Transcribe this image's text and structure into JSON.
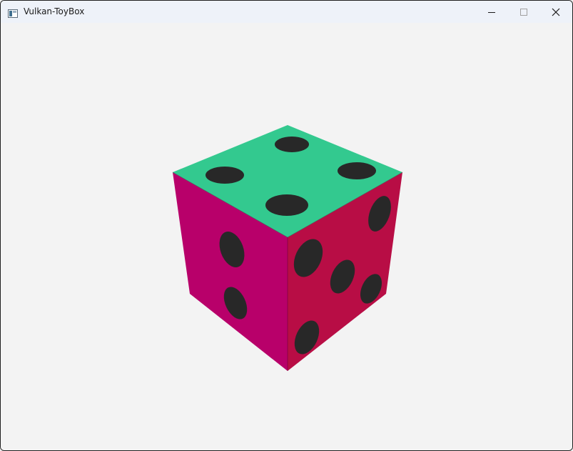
{
  "window": {
    "title": "Vulkan-ToyBox",
    "controls": {
      "minimize": "minimize-icon",
      "maximize": "maximize-icon",
      "close": "close-icon"
    }
  },
  "scene": {
    "object": "dice",
    "colors": {
      "background": "#f3f3f3",
      "top_face": "#33c98f",
      "left_face": "#b8006a",
      "right_face": "#b80d45",
      "pips": "#282828"
    },
    "visible_faces": {
      "top_pips": 4,
      "left_pips": 2,
      "right_pips": 5
    }
  }
}
